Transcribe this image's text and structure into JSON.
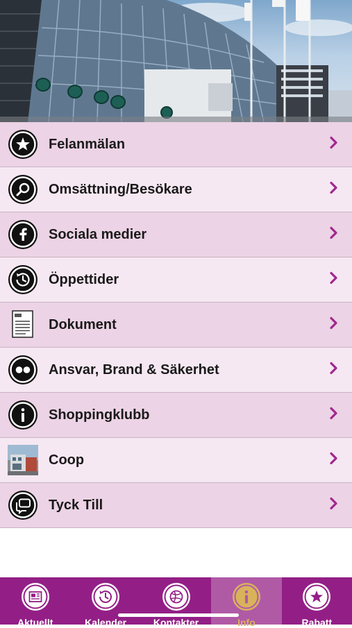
{
  "menu": {
    "items": [
      {
        "label": "Felanmälan",
        "icon": "star-icon"
      },
      {
        "label": "Omsättning/Besökare",
        "icon": "search-icon"
      },
      {
        "label": "Sociala medier",
        "icon": "facebook-icon"
      },
      {
        "label": "Öppettider",
        "icon": "clock-icon"
      },
      {
        "label": "Dokument",
        "icon": "pdf-document-icon"
      },
      {
        "label": "Ansvar, Brand & Säkerhet",
        "icon": "flickr-dots-icon"
      },
      {
        "label": "Shoppingklubb",
        "icon": "info-icon"
      },
      {
        "label": "Coop",
        "icon": "store-photo-thumbnail"
      },
      {
        "label": "Tyck Till",
        "icon": "chat-bubbles-icon"
      }
    ]
  },
  "tabbar": {
    "active_index": 3,
    "tabs": [
      {
        "label": "Aktuellt",
        "icon": "newspaper-icon"
      },
      {
        "label": "Kalender",
        "icon": "history-clock-icon"
      },
      {
        "label": "Kontakter",
        "icon": "basketball-icon"
      },
      {
        "label": "Info",
        "icon": "info-icon"
      },
      {
        "label": "Rabatt",
        "icon": "star-icon"
      }
    ]
  },
  "colors": {
    "tabbar_bg": "#931f86",
    "tabbar_active_bg": "#b05aa6",
    "active_label": "#d9b25c",
    "row_dark": "#ecd3e5",
    "row_light": "#f6e8f2",
    "chevron": "#a0288f"
  }
}
